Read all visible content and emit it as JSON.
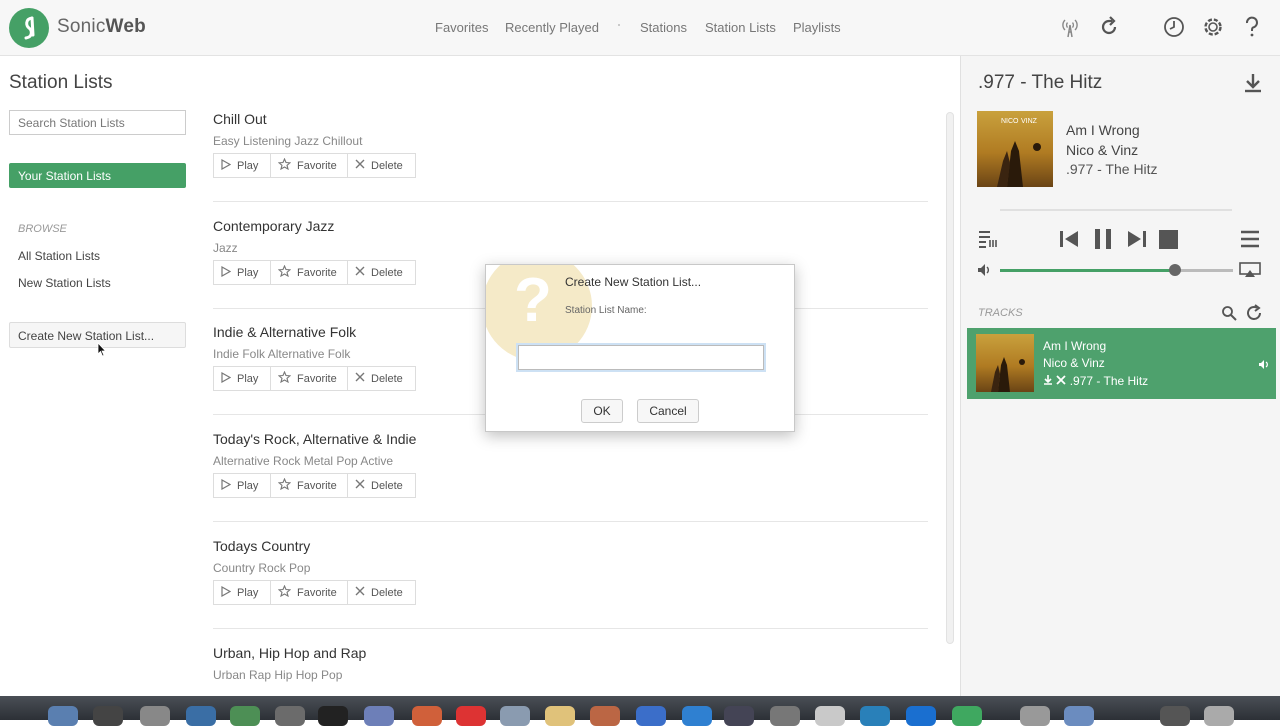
{
  "app": {
    "brand_light": "Sonic",
    "brand_bold": "Web",
    "accent": "#45a066"
  },
  "nav": {
    "items": [
      "Favorites",
      "Recently Played",
      "Stations",
      "Station Lists",
      "Playlists"
    ]
  },
  "top_icons": [
    "signal-icon",
    "refresh-icon",
    "clock-icon",
    "settings-icon",
    "help-icon"
  ],
  "left": {
    "title": "Station Lists",
    "search_placeholder": "Search Station Lists",
    "your_lists": "Your Station Lists",
    "browse_header": "BROWSE",
    "browse_items": [
      "All Station Lists",
      "New Station Lists"
    ],
    "create_button": "Create New Station List..."
  },
  "stations": [
    {
      "name": "Chill Out",
      "tags": "Easy Listening Jazz Chillout"
    },
    {
      "name": "Contemporary Jazz",
      "tags": "Jazz"
    },
    {
      "name": "Indie & Alternative Folk",
      "tags": "Indie Folk Alternative Folk"
    },
    {
      "name": "Today's Rock, Alternative & Indie",
      "tags": "Alternative Rock Metal Pop Active"
    },
    {
      "name": "Todays Country",
      "tags": "Country Rock Pop"
    },
    {
      "name": "Urban, Hip Hop and Rap",
      "tags": "Urban Rap Hip Hop Pop"
    }
  ],
  "actions": {
    "play": "Play",
    "favorite": "Favorite",
    "delete": "Delete"
  },
  "now_playing": {
    "station": ".977 - The Hitz",
    "track": "Am I Wrong",
    "artist": "Nico & Vinz",
    "source": ".977 - The Hitz",
    "volume_percent": 75
  },
  "tracks": {
    "header": "TRACKS",
    "items": [
      {
        "title": "Am I Wrong",
        "artist": "Nico & Vinz",
        "station": ".977 - The Hitz"
      }
    ]
  },
  "dialog": {
    "title": "Create New Station List...",
    "label": "Station List Name:",
    "value": "",
    "ok": "OK",
    "cancel": "Cancel"
  }
}
